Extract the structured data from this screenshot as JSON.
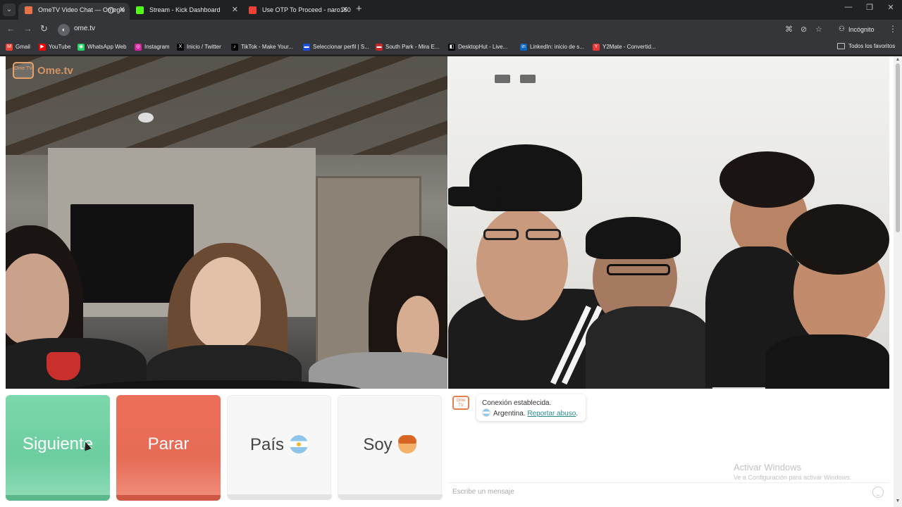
{
  "tabs": [
    {
      "title": "OmeTV Video Chat — Omegle",
      "favicon_color": "#e8734a",
      "active": true,
      "recording": true
    },
    {
      "title": "Stream - Kick Dashboard",
      "favicon_color": "#53fc18",
      "active": false,
      "recording": false
    },
    {
      "title": "Use OTP To Proceed - naro160",
      "favicon_color": "#ea4335",
      "active": false,
      "recording": false
    }
  ],
  "toolbar": {
    "url": "ome.tv",
    "profile_label": "Incógnito"
  },
  "bookmarks": [
    {
      "label": "Gmail",
      "color": "#ea4335",
      "glyph": "M"
    },
    {
      "label": "YouTube",
      "color": "#ff0000",
      "glyph": "▶"
    },
    {
      "label": "WhatsApp Web",
      "color": "#25d366",
      "glyph": "◉"
    },
    {
      "label": "Instagram",
      "color": "#d6249f",
      "glyph": "◎"
    },
    {
      "label": "Inicio / Twitter",
      "color": "#000000",
      "glyph": "X"
    },
    {
      "label": "TikTok - Make Your...",
      "color": "#000000",
      "glyph": "♪"
    },
    {
      "label": "Seleccionar perfil | S...",
      "color": "#1d4ed8",
      "glyph": "▬"
    },
    {
      "label": "South Park - Mira E...",
      "color": "#c62828",
      "glyph": "▬"
    },
    {
      "label": "DesktopHut - Live...",
      "color": "#000000",
      "glyph": "◧"
    },
    {
      "label": "LinkedIn: inicio de s...",
      "color": "#0a66c2",
      "glyph": "in"
    },
    {
      "label": "Y2Mate - Convertid...",
      "color": "#e53935",
      "glyph": "Y"
    }
  ],
  "bookmarks_all": "Todos los favoritos",
  "logo": {
    "mark": "Ome TV",
    "text": "Ome.tv"
  },
  "controls": {
    "next": "Siguiente",
    "stop": "Parar",
    "country": "País",
    "gender": "Soy"
  },
  "chat": {
    "avatar_text": "Ome TV",
    "status": "Conexión establecida.",
    "country": "Argentina.",
    "report": "Reportar abuso",
    "report_suffix": ".",
    "placeholder": "Escribe un mensaje"
  },
  "watermark": {
    "title": "Activar Windows",
    "subtitle": "Ve a Configuración para activar Windows."
  },
  "colors": {
    "next_button": "#6ccd9f",
    "stop_button": "#e66b56",
    "brand": "#e8734a"
  }
}
